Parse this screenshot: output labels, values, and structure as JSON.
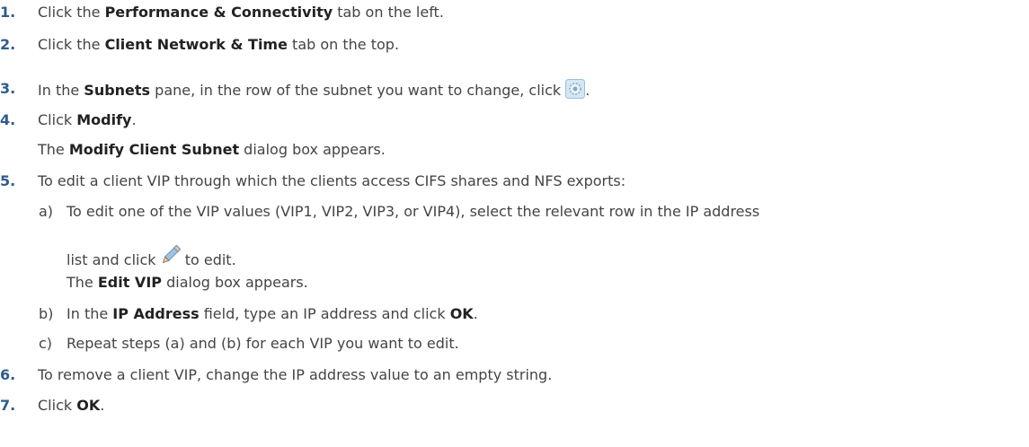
{
  "steps": [
    {
      "num": "1.",
      "a": "Click the ",
      "b": "Performance & Connectivity",
      "c": " tab on the left."
    },
    {
      "num": "2.",
      "a": "Click the ",
      "b": "Client Network & Time",
      "c": " tab on the top."
    },
    {
      "num": "3.",
      "a": "In the ",
      "b": "Subnets",
      "c": " pane, in the row of the subnet you want to change, click ",
      "d": "."
    },
    {
      "num": "4.",
      "a": "Click ",
      "b": "Modify",
      "c": "."
    },
    {
      "note_a": "The ",
      "note_b": "Modify Client Subnet",
      "note_c": " dialog box appears."
    },
    {
      "num": "5.",
      "a": "To edit a client VIP through which the clients access CIFS shares and NFS exports:"
    },
    {
      "num": "6.",
      "a": "To remove a client VIP, change the IP address value to an empty string."
    },
    {
      "num": "7.",
      "a": "Click ",
      "b": "OK",
      "c": "."
    }
  ],
  "substeps": [
    {
      "label": "a)",
      "a": "To edit one of the VIP values (VIP1, VIP2, VIP3, or VIP4), select the relevant row in the IP address",
      "cont_a": "list and click ",
      "cont_b": " to edit.",
      "note_a": "The ",
      "note_b": "Edit VIP",
      "note_c": " dialog box appears."
    },
    {
      "label": "b)",
      "a": "In the ",
      "b": "IP Address",
      "c": " field, type an IP address and click ",
      "d": "OK",
      "e": "."
    },
    {
      "label": "c)",
      "a": "Repeat steps (a) and (b) for each VIP you want to edit."
    }
  ],
  "icons": {
    "step3": "gear-icon",
    "substep_a": "pencil-icon"
  }
}
